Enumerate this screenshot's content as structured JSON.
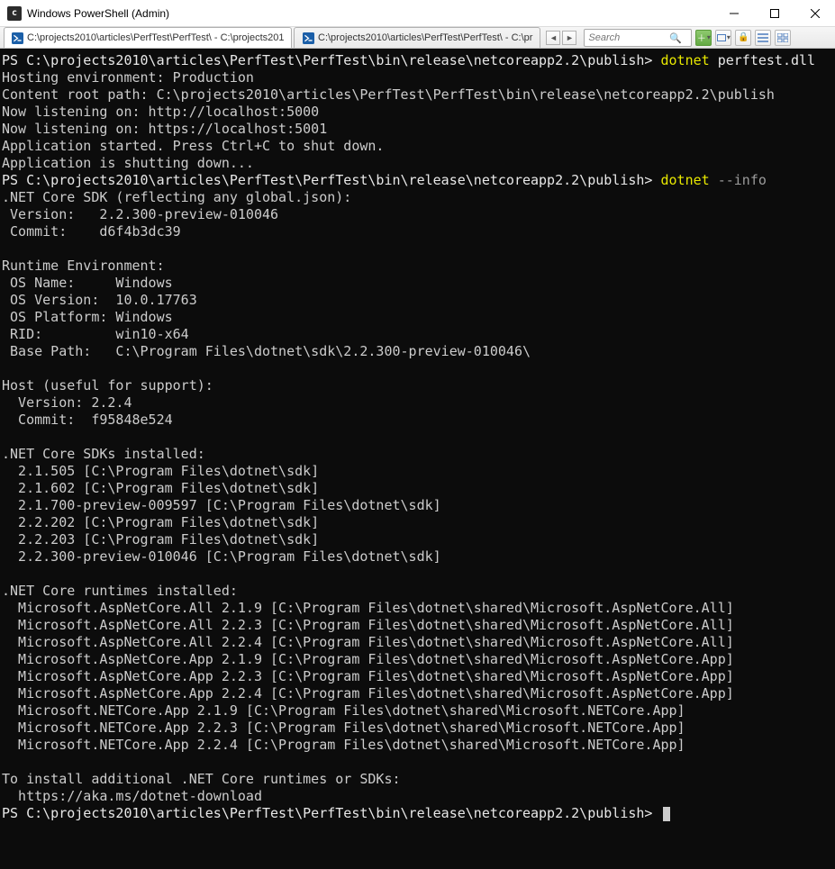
{
  "window": {
    "title": "Windows PowerShell (Admin)"
  },
  "tabs": {
    "tab1": "C:\\projects2010\\articles\\PerfTest\\PerfTest\\ - C:\\projects201",
    "tab2": "C:\\projects2010\\articles\\PerfTest\\PerfTest\\ - C:\\pr"
  },
  "search": {
    "placeholder": "Search"
  },
  "terminal": {
    "prompt": "PS C:\\projects2010\\articles\\PerfTest\\PerfTest\\bin\\release\\netcoreapp2.2\\publish> ",
    "cmd1_a": "dotnet",
    "cmd1_b": " perftest.dll",
    "l2": "Hosting environment: Production",
    "l3": "Content root path: C:\\projects2010\\articles\\PerfTest\\PerfTest\\bin\\release\\netcoreapp2.2\\publish",
    "l4": "Now listening on: http://localhost:5000",
    "l5": "Now listening on: https://localhost:5001",
    "l6": "Application started. Press Ctrl+C to shut down.",
    "l7": "Application is shutting down...",
    "cmd2_a": "dotnet",
    "cmd2_b": " --info",
    "l9": ".NET Core SDK (reflecting any global.json):",
    "l10": " Version:   2.2.300-preview-010046",
    "l11": " Commit:    d6f4b3dc39",
    "l12": "",
    "l13": "Runtime Environment:",
    "l14": " OS Name:     Windows",
    "l15": " OS Version:  10.0.17763",
    "l16": " OS Platform: Windows",
    "l17": " RID:         win10-x64",
    "l18": " Base Path:   C:\\Program Files\\dotnet\\sdk\\2.2.300-preview-010046\\",
    "l19": "",
    "l20": "Host (useful for support):",
    "l21": "  Version: 2.2.4",
    "l22": "  Commit:  f95848e524",
    "l23": "",
    "l24": ".NET Core SDKs installed:",
    "l25": "  2.1.505 [C:\\Program Files\\dotnet\\sdk]",
    "l26": "  2.1.602 [C:\\Program Files\\dotnet\\sdk]",
    "l27": "  2.1.700-preview-009597 [C:\\Program Files\\dotnet\\sdk]",
    "l28": "  2.2.202 [C:\\Program Files\\dotnet\\sdk]",
    "l29": "  2.2.203 [C:\\Program Files\\dotnet\\sdk]",
    "l30": "  2.2.300-preview-010046 [C:\\Program Files\\dotnet\\sdk]",
    "l31": "",
    "l32": ".NET Core runtimes installed:",
    "l33": "  Microsoft.AspNetCore.All 2.1.9 [C:\\Program Files\\dotnet\\shared\\Microsoft.AspNetCore.All]",
    "l34": "  Microsoft.AspNetCore.All 2.2.3 [C:\\Program Files\\dotnet\\shared\\Microsoft.AspNetCore.All]",
    "l35": "  Microsoft.AspNetCore.All 2.2.4 [C:\\Program Files\\dotnet\\shared\\Microsoft.AspNetCore.All]",
    "l36": "  Microsoft.AspNetCore.App 2.1.9 [C:\\Program Files\\dotnet\\shared\\Microsoft.AspNetCore.App]",
    "l37": "  Microsoft.AspNetCore.App 2.2.3 [C:\\Program Files\\dotnet\\shared\\Microsoft.AspNetCore.App]",
    "l38": "  Microsoft.AspNetCore.App 2.2.4 [C:\\Program Files\\dotnet\\shared\\Microsoft.AspNetCore.App]",
    "l39": "  Microsoft.NETCore.App 2.1.9 [C:\\Program Files\\dotnet\\shared\\Microsoft.NETCore.App]",
    "l40": "  Microsoft.NETCore.App 2.2.3 [C:\\Program Files\\dotnet\\shared\\Microsoft.NETCore.App]",
    "l41": "  Microsoft.NETCore.App 2.2.4 [C:\\Program Files\\dotnet\\shared\\Microsoft.NETCore.App]",
    "l42": "",
    "l43": "To install additional .NET Core runtimes or SDKs:",
    "l44": "  https://aka.ms/dotnet-download"
  }
}
